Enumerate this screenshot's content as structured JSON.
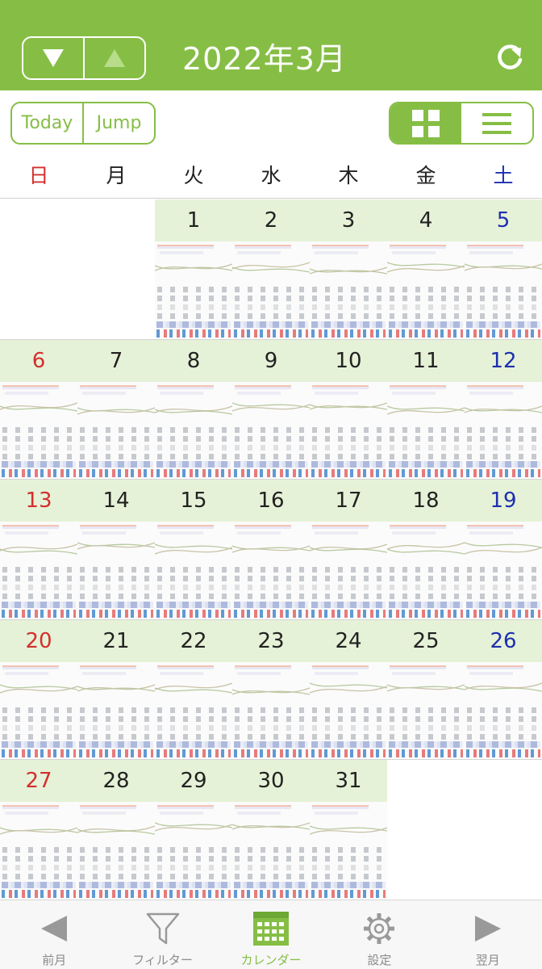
{
  "header": {
    "title": "2022年3月",
    "prev_icon": "down-triangle-icon",
    "next_icon": "up-triangle-icon",
    "refresh_icon": "refresh-icon",
    "color": "#86be45"
  },
  "toolbar": {
    "today_label": "Today",
    "jump_label": "Jump",
    "view_grid_icon": "grid-icon",
    "view_list_icon": "list-icon"
  },
  "weekdays": [
    "日",
    "月",
    "火",
    "水",
    "木",
    "金",
    "土"
  ],
  "calendar": {
    "weeks": [
      [
        "",
        "",
        "1",
        "2",
        "3",
        "4",
        "5"
      ],
      [
        "6",
        "7",
        "8",
        "9",
        "10",
        "11",
        "12"
      ],
      [
        "13",
        "14",
        "15",
        "16",
        "17",
        "18",
        "19"
      ],
      [
        "20",
        "21",
        "22",
        "23",
        "24",
        "25",
        "26"
      ],
      [
        "27",
        "28",
        "29",
        "30",
        "31",
        "",
        ""
      ]
    ]
  },
  "tabs": [
    {
      "label": "前月",
      "icon": "left-triangle-icon"
    },
    {
      "label": "フィルター",
      "icon": "filter-icon"
    },
    {
      "label": "カレンダー",
      "icon": "calendar-icon"
    },
    {
      "label": "設定",
      "icon": "gear-icon"
    },
    {
      "label": "翌月",
      "icon": "right-triangle-icon"
    }
  ]
}
